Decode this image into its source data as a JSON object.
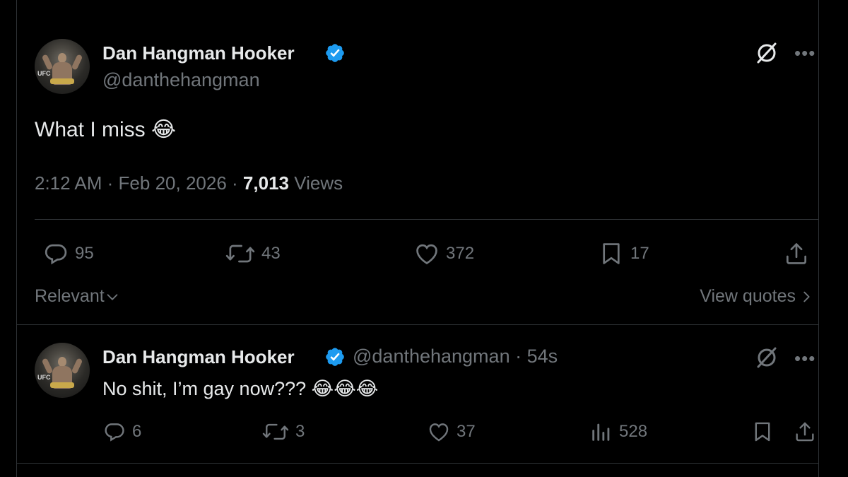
{
  "main_tweet": {
    "author_name": "Dan Hangman Hooker",
    "handle": "@danthehangman",
    "text": "What I miss",
    "emoji": "😂",
    "time": "2:12 AM",
    "date": "Feb 20, 2026",
    "views_count": "7,013",
    "views_label": "Views",
    "separator": "·",
    "actions": {
      "replies": "95",
      "reposts": "43",
      "likes": "372",
      "bookmarks": "17"
    }
  },
  "sort": {
    "label": "Relevant",
    "view_quotes_label": "View quotes"
  },
  "reply_tweet": {
    "author_name": "Dan Hangman Hooker",
    "handle": "@danthehangman",
    "separator": "·",
    "age": "54s",
    "text": "No shit, I’m gay now???",
    "emoji": "😂😂😂",
    "actions": {
      "replies": "6",
      "reposts": "3",
      "likes": "37",
      "views": "528"
    }
  },
  "colors": {
    "background": "#000000",
    "text_primary": "#e7e9ea",
    "text_secondary": "#71767b",
    "verified": "#1d9bf0",
    "divider": "#2f3336"
  },
  "icons": [
    "verified-badge-icon",
    "grok-icon",
    "more-icon",
    "reply-icon",
    "repost-icon",
    "like-icon",
    "bookmark-icon",
    "share-icon",
    "views-icon",
    "chevron-down-icon",
    "chevron-right-icon"
  ]
}
